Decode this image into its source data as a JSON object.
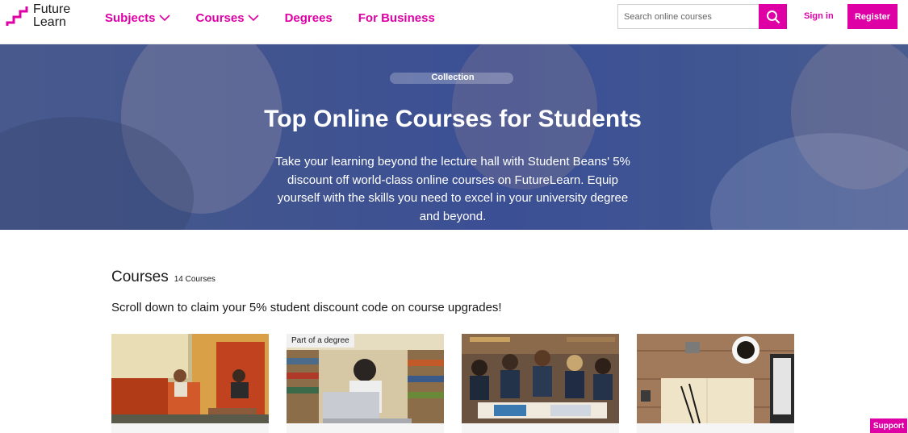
{
  "brand": {
    "logo_line1": "Future",
    "logo_line2": "Learn",
    "accent_color": "#de00a5"
  },
  "nav": {
    "items": [
      {
        "label": "Subjects",
        "has_dropdown": true
      },
      {
        "label": "Courses",
        "has_dropdown": true
      },
      {
        "label": "Degrees",
        "has_dropdown": false
      },
      {
        "label": "For Business",
        "has_dropdown": false
      }
    ]
  },
  "search": {
    "placeholder": "Search online courses",
    "icon": "search-icon"
  },
  "auth": {
    "signin_label": "Sign in",
    "register_label": "Register"
  },
  "hero": {
    "tag": "Collection",
    "title": "Top Online Courses for Students",
    "description": "Take your learning beyond the lecture hall with Student Beans' 5% discount off world-class online courses on FutureLearn. Equip yourself with the skills you need to excel in your university degree and beyond."
  },
  "courses": {
    "heading": "Courses",
    "count": "14 Courses",
    "subtitle": "Scroll down to claim your 5% student discount code on course upgrades!",
    "cards": [
      {
        "image": "students-studying-library-image",
        "badge": ""
      },
      {
        "image": "student-with-laptop-image",
        "badge": "Part of a degree"
      },
      {
        "image": "student-group-reading-image",
        "badge": ""
      },
      {
        "image": "desk-notebook-coffee-image",
        "badge": ""
      }
    ]
  },
  "support": {
    "label": "Support"
  }
}
